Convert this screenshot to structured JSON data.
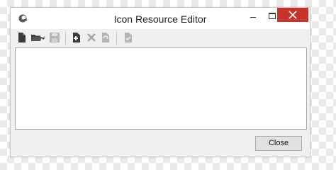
{
  "window": {
    "title": "Icon Resource Editor",
    "app_icon": "app-logo-icon",
    "controls": [
      "minimize-icon",
      "maximize-icon",
      "close-icon"
    ],
    "close_button_color": "#c7342b"
  },
  "toolbar": {
    "items": [
      {
        "icon": "new-file-icon",
        "enabled": true
      },
      {
        "icon": "open-folder-icon",
        "enabled": true
      },
      {
        "icon": "dropdown-arrow-icon",
        "enabled": true
      },
      {
        "icon": "save-icon",
        "enabled": false
      },
      {
        "icon": "add-resource-icon",
        "enabled": true
      },
      {
        "icon": "delete-icon",
        "enabled": false
      },
      {
        "icon": "replace-icon",
        "enabled": false
      },
      {
        "icon": "apply-icon",
        "enabled": false
      }
    ]
  },
  "footer": {
    "close_label": "Close"
  }
}
